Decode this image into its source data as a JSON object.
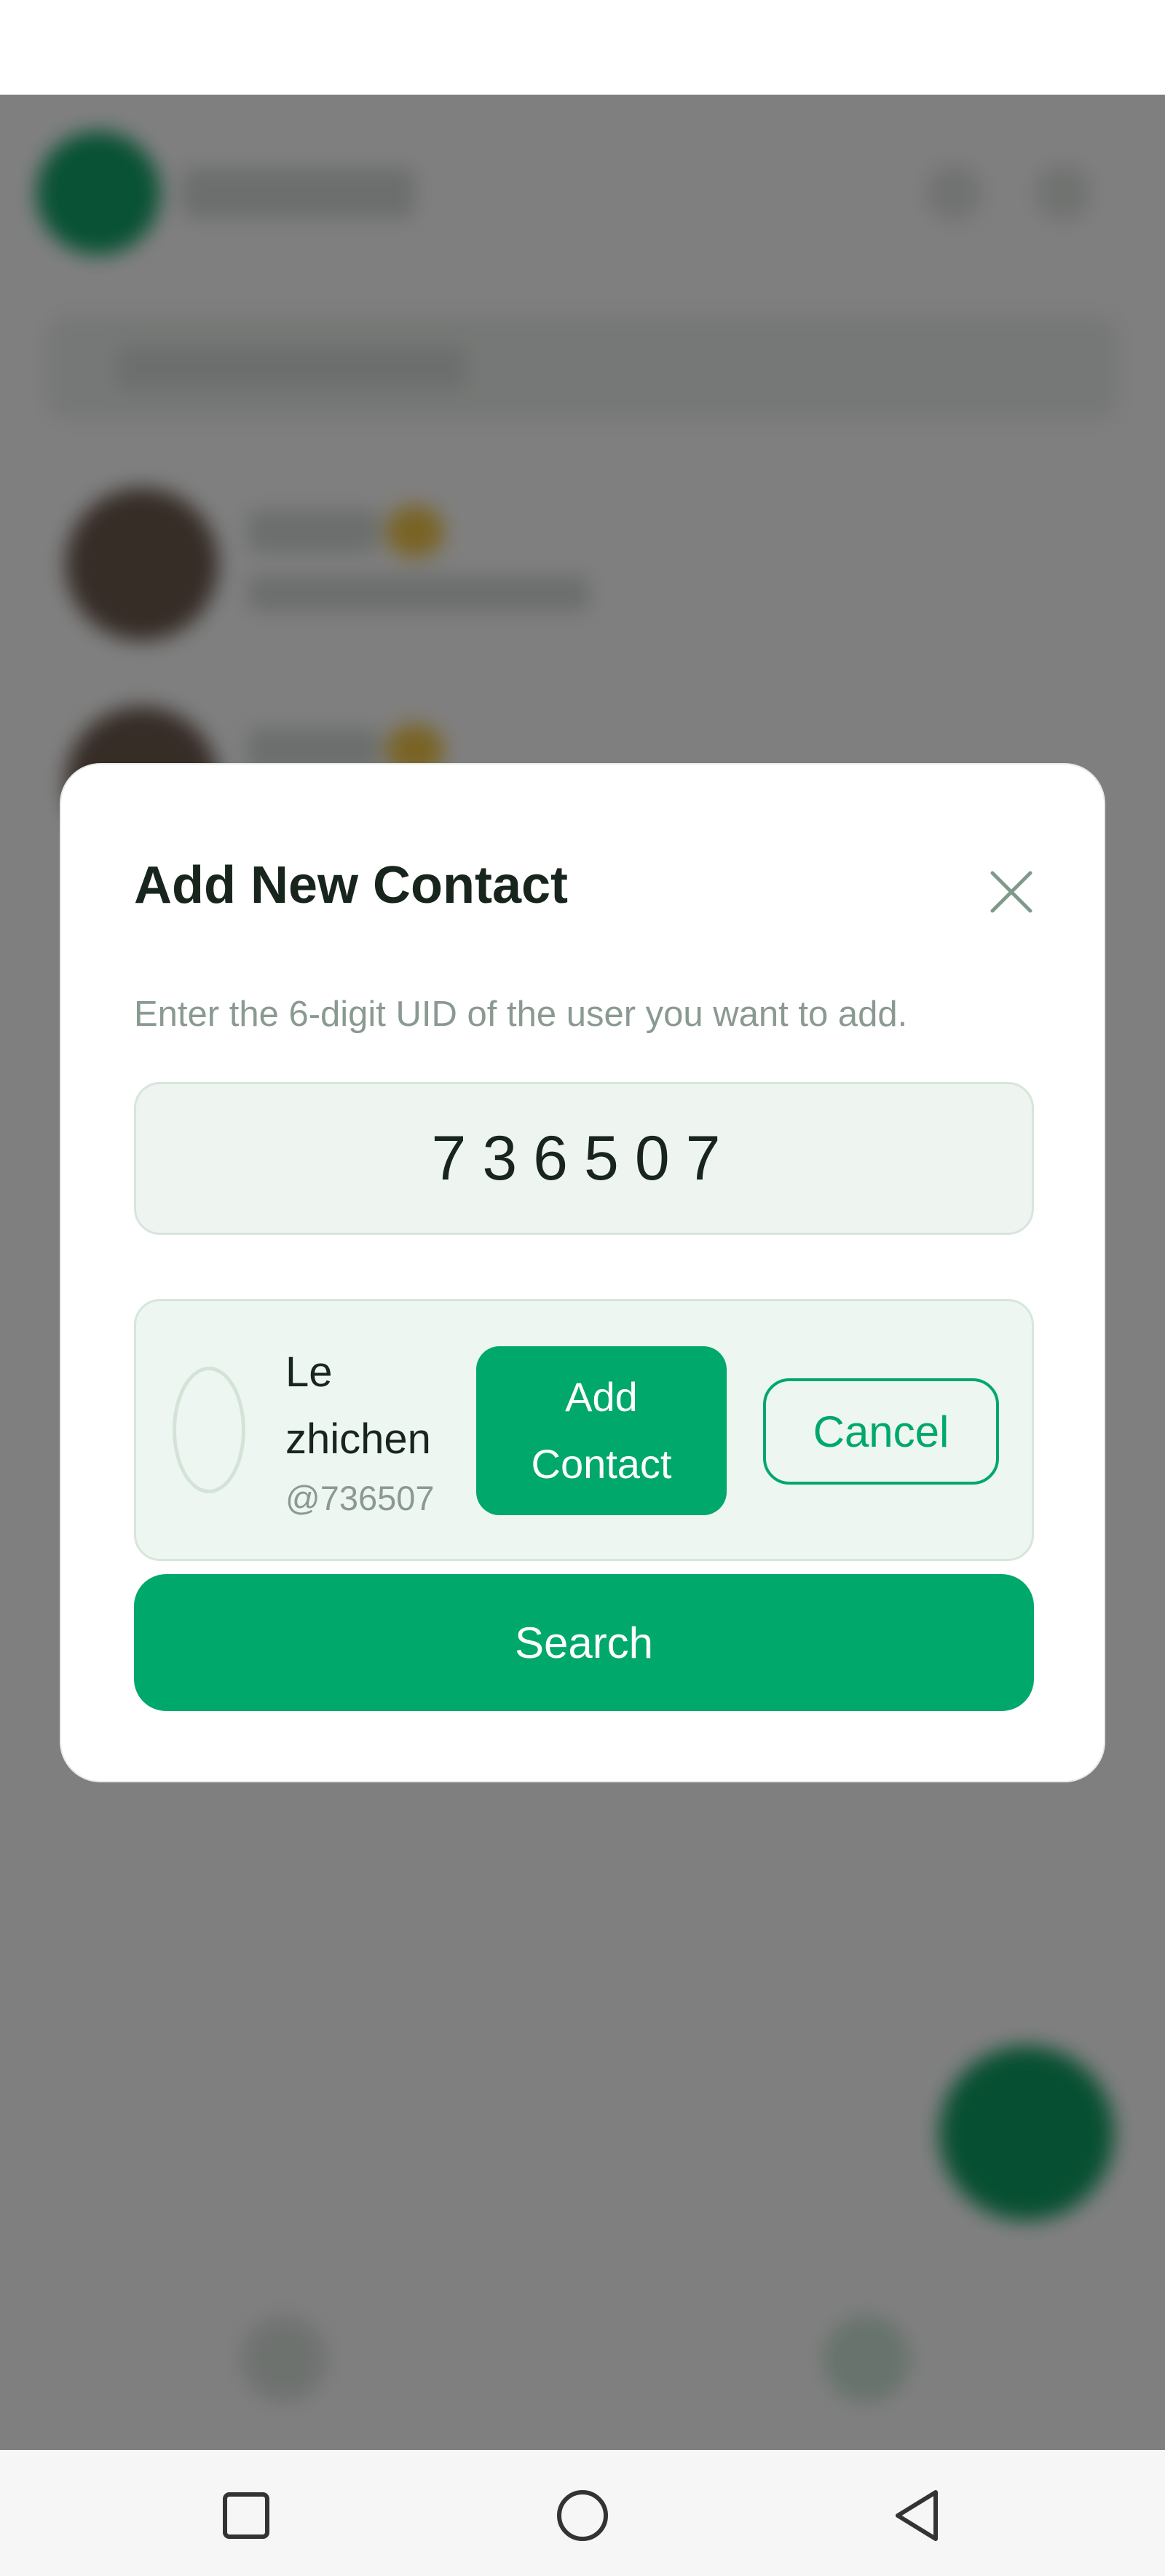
{
  "dialog": {
    "title": "Add New Contact",
    "description": "Enter the 6-digit UID of the user you want to add.",
    "uid_input_value": "736507",
    "result": {
      "name": "Le zhichen",
      "uid": "@736507",
      "add_label": "Add Contact",
      "cancel_label": "Cancel"
    },
    "search_label": "Search"
  },
  "icons": {
    "close": "close-icon",
    "recents": "square-recents-icon",
    "home": "circle-home-icon",
    "back": "triangle-back-icon"
  },
  "colors": {
    "accent": "#00a86b",
    "overlay": "rgba(0,0,0,0.5)",
    "title_text": "#17251d",
    "muted_text": "#8a9a91",
    "input_bg": "#eef4f0"
  }
}
